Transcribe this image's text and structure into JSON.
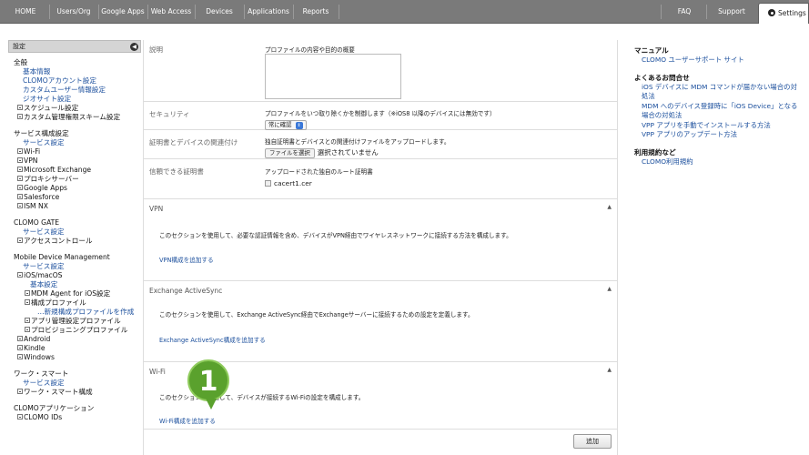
{
  "topnav": {
    "items": [
      "HOME",
      "Users/Org",
      "Google Apps",
      "Web Access",
      "Devices",
      "Applications",
      "Reports"
    ],
    "faq": "FAQ",
    "support": "Support",
    "settings": "Settings"
  },
  "sidebar": {
    "header": "設定",
    "collapse_glyph": "◀",
    "groups": [
      {
        "title": "全般",
        "items": [
          {
            "label": "基本情報",
            "type": "link",
            "indent": 1
          },
          {
            "label": "CLOMOアカウント設定",
            "type": "link",
            "indent": 1
          },
          {
            "label": "カスタムユーザー情報設定",
            "type": "link",
            "indent": 1
          },
          {
            "label": "ジオサイト設定",
            "type": "link",
            "indent": 1
          },
          {
            "label": "スケジュール設定",
            "type": "tree",
            "indent": 1
          },
          {
            "label": "カスタム管理権限スキーム設定",
            "type": "tree",
            "indent": 1
          }
        ]
      },
      {
        "title": "サービス構成設定",
        "items": [
          {
            "label": "サービス設定",
            "type": "link",
            "indent": 1
          },
          {
            "label": "Wi-Fi",
            "type": "tree",
            "indent": 1
          },
          {
            "label": "VPN",
            "type": "tree",
            "indent": 1
          },
          {
            "label": "Microsoft Exchange",
            "type": "tree",
            "indent": 1
          },
          {
            "label": "プロキシサーバー",
            "type": "tree",
            "indent": 1
          },
          {
            "label": "Google Apps",
            "type": "tree",
            "indent": 1
          },
          {
            "label": "Salesforce",
            "type": "tree",
            "indent": 1
          },
          {
            "label": "ISM NX",
            "type": "tree",
            "indent": 1
          }
        ]
      },
      {
        "title": "CLOMO GATE",
        "items": [
          {
            "label": "サービス設定",
            "type": "link",
            "indent": 1
          },
          {
            "label": "アクセスコントロール",
            "type": "tree",
            "indent": 1
          }
        ]
      },
      {
        "title": "Mobile Device Management",
        "items": [
          {
            "label": "サービス設定",
            "type": "link",
            "indent": 1
          },
          {
            "label": "iOS/macOS",
            "type": "tree",
            "indent": 1
          },
          {
            "label": "基本設定",
            "type": "link",
            "indent": 2
          },
          {
            "label": "MDM Agent for iOS設定",
            "type": "tree",
            "indent": 2
          },
          {
            "label": "構成プロファイル",
            "type": "tree",
            "indent": 2
          },
          {
            "label": "…新規構成プロファイルを作成",
            "type": "link",
            "indent": 3
          },
          {
            "label": "アプリ管理設定プロファイル",
            "type": "tree",
            "indent": 2
          },
          {
            "label": "プロビジョニングプロファイル",
            "type": "tree",
            "indent": 2
          },
          {
            "label": "Android",
            "type": "tree",
            "indent": 1
          },
          {
            "label": "Kindle",
            "type": "tree",
            "indent": 1
          },
          {
            "label": "Windows",
            "type": "tree",
            "indent": 1
          }
        ]
      },
      {
        "title": "ワーク・スマート",
        "items": [
          {
            "label": "サービス設定",
            "type": "link",
            "indent": 1
          },
          {
            "label": "ワーク・スマート構成",
            "type": "tree",
            "indent": 1
          }
        ]
      },
      {
        "title": "CLOMOアプリケーション",
        "items": [
          {
            "label": "CLOMO IDs",
            "type": "tree",
            "indent": 1
          }
        ]
      }
    ]
  },
  "form": {
    "description": {
      "label": "説明",
      "hint": "プロファイルの内容や目的の概要"
    },
    "security": {
      "label": "セキュリティ",
      "hint": "プロファイルをいつ取り除くかを制御します（※iOS8 以降のデバイスには無効です）",
      "select_value": "常に確認"
    },
    "cert_assoc": {
      "label": "証明書とデバイスの関連付け",
      "hint": "独自証明書とデバイスとの関連付けファイルをアップロードします。",
      "file_button": "ファイルを選択",
      "file_status": "選択されていません"
    },
    "trusted_cert": {
      "label": "信頼できる証明書",
      "hint": "アップロードされた独自のルート証明書",
      "file_name": "cacert1.cer"
    }
  },
  "sections": [
    {
      "title": "VPN",
      "desc": "このセクションを使用して、必要な認証情報を含め、デバイスがVPN経由でワイヤレスネットワークに接続する方法を構成します。",
      "link": "VPN構成を追加する"
    },
    {
      "title": "Exchange ActiveSync",
      "desc": "このセクションを使用して、Exchange ActiveSync経由でExchangeサーバーに接続するための設定を定義します。",
      "link": "Exchange ActiveSync構成を追加する"
    },
    {
      "title": "Wi-Fi",
      "desc": "このセクションを使用して、デバイスが接続するWi-Fiの設定を構成します。",
      "link": "Wi-Fi構成を追加する"
    }
  ],
  "collapse_arrow": "▲",
  "add_button": "追加",
  "callout_number": "1",
  "right_panel": {
    "manual_title": "マニュアル",
    "manual_links": [
      "CLOMO ユーザーサポート サイト"
    ],
    "faq_title": "よくあるお問合せ",
    "faq_links": [
      "iOS デバイスに MDM コマンドが届かない場合の対処法",
      "MDM へのデバイス登録時に「iOS Device」となる場合の対処法",
      "VPP アプリを手動でインストールする方法",
      "VPP アプリのアップデート方法"
    ],
    "terms_title": "利用規約など",
    "terms_links": [
      "CLOMO利用規約"
    ]
  }
}
